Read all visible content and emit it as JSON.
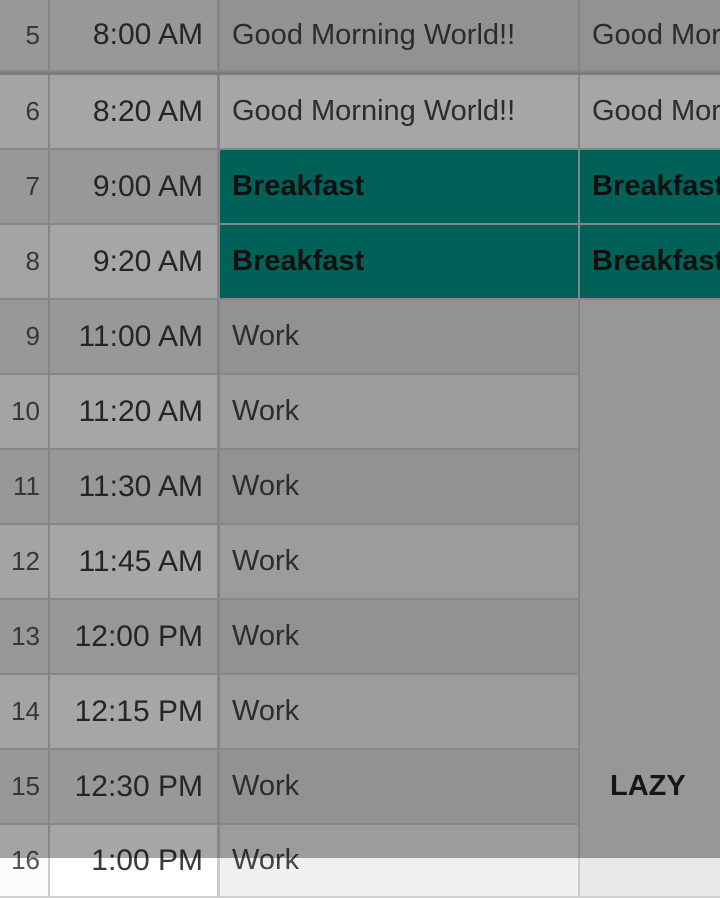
{
  "schedule": {
    "rows": [
      {
        "index": "5",
        "time": "8:00 AM",
        "event1": "Good Morning World!!",
        "event2": "Good Mor"
      },
      {
        "index": "6",
        "time": "8:20 AM",
        "event1": "Good Morning World!!",
        "event2": "Good Mor"
      },
      {
        "index": "7",
        "time": "9:00 AM",
        "event1": "Breakfast",
        "event2": "Breakfast",
        "highlight": true
      },
      {
        "index": "8",
        "time": "9:20 AM",
        "event1": "Breakfast",
        "event2": "Breakfast",
        "highlight": true
      },
      {
        "index": "9",
        "time": "11:00 AM",
        "event1": "Work"
      },
      {
        "index": "10",
        "time": "11:20 AM",
        "event1": "Work"
      },
      {
        "index": "11",
        "time": "11:30 AM",
        "event1": "Work"
      },
      {
        "index": "12",
        "time": "11:45 AM",
        "event1": "Work"
      },
      {
        "index": "13",
        "time": "12:00 PM",
        "event1": "Work"
      },
      {
        "index": "14",
        "time": "12:15 PM",
        "event1": "Work"
      },
      {
        "index": "15",
        "time": "12:30 PM",
        "event1": "Work"
      },
      {
        "index": "16",
        "time": "1:00 PM",
        "event1": "Work"
      }
    ],
    "merged_label": "LAZY",
    "colors": {
      "highlight": "#009688"
    }
  }
}
